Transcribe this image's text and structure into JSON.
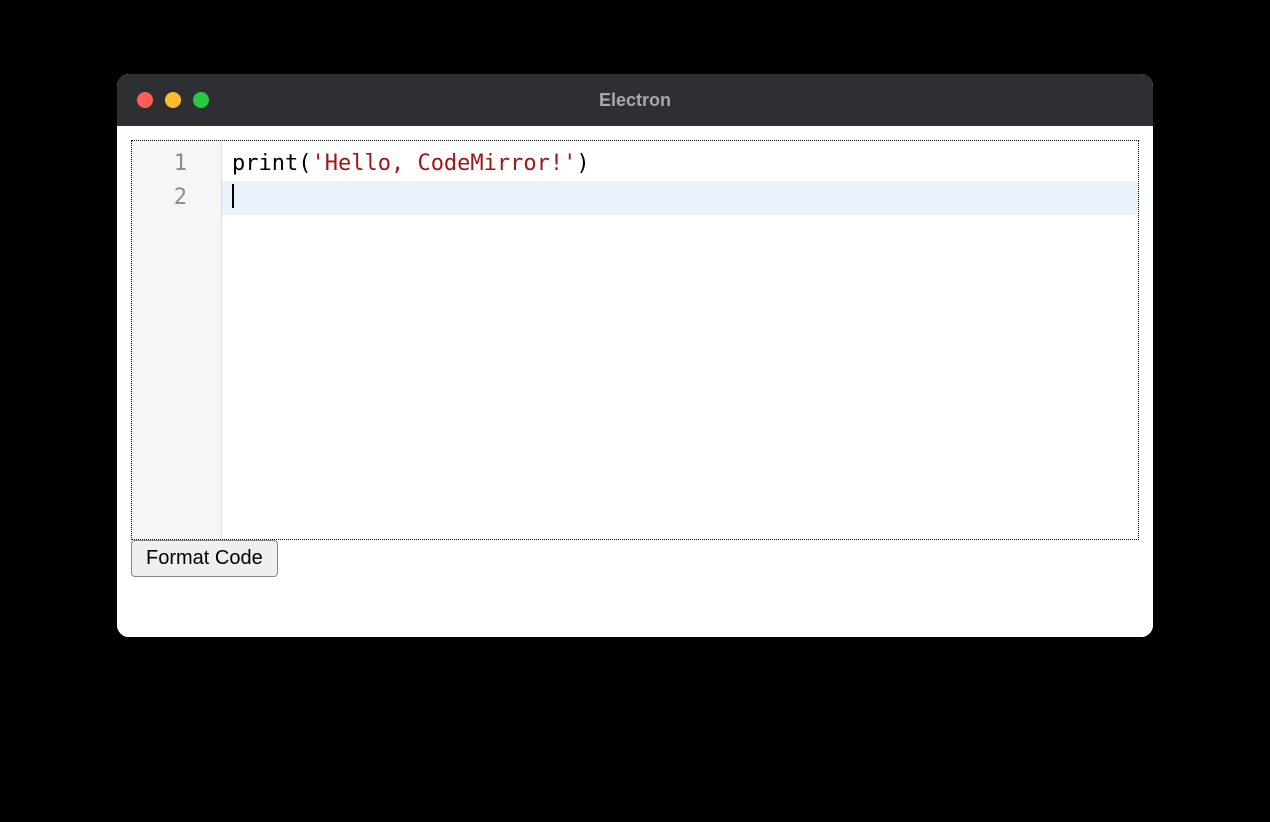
{
  "window": {
    "title": "Electron"
  },
  "editor": {
    "gutter": {
      "line1": "1",
      "line2": "2"
    },
    "code": {
      "line1": {
        "func": "print",
        "open": "(",
        "string": "'Hello, CodeMirror!'",
        "close": ")"
      },
      "line2": ""
    },
    "active_line": 2
  },
  "buttons": {
    "format": "Format Code"
  },
  "colors": {
    "titlebar_bg": "#2e2f33",
    "traffic_close": "#ff5f57",
    "traffic_minimize": "#febc2e",
    "traffic_zoom": "#28c840",
    "gutter_bg": "#f6f6f6",
    "active_line_bg": "#e9f2fb",
    "string_color": "#a31515"
  }
}
